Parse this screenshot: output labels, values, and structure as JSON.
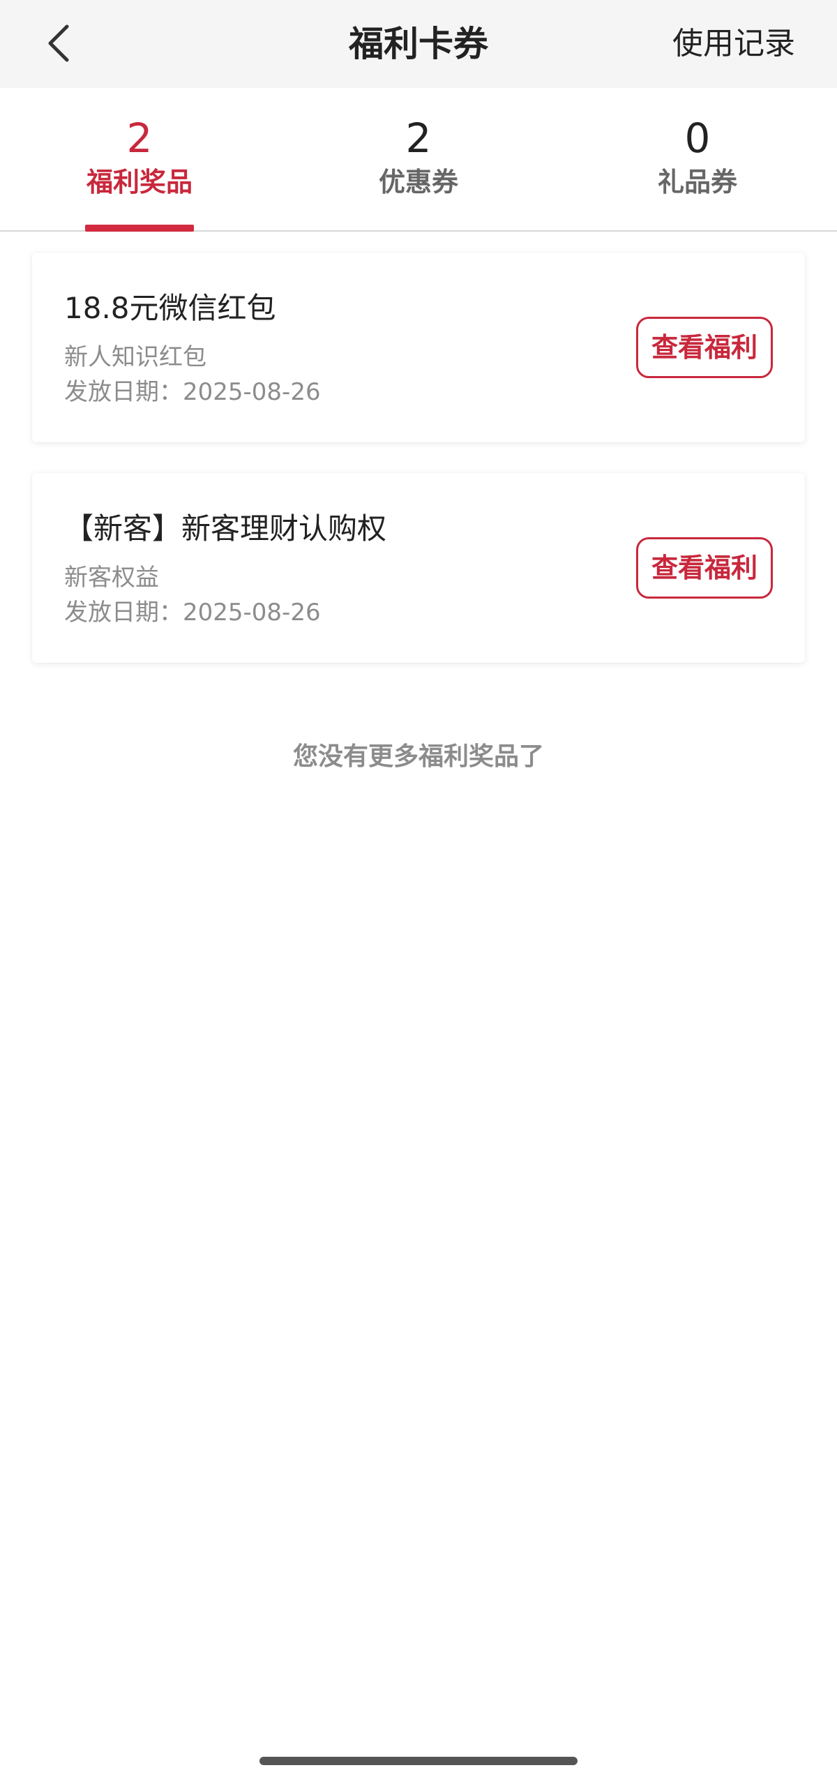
{
  "header": {
    "title": "福利卡券",
    "history_label": "使用记录",
    "back_icon": "chevron-left-icon"
  },
  "tabs": [
    {
      "count": "2",
      "label": "福利奖品",
      "active": true
    },
    {
      "count": "2",
      "label": "优惠券",
      "active": false
    },
    {
      "count": "0",
      "label": "礼品券",
      "active": false
    }
  ],
  "cards": [
    {
      "title": "18.8元微信红包",
      "subtitle": "新人知识红包",
      "date": "发放日期：2025-08-26",
      "button_label": "查看福利"
    },
    {
      "title": "【新客】新客理财认购权",
      "subtitle": "新客权益",
      "date": "发放日期：2025-08-26",
      "button_label": "查看福利"
    }
  ],
  "footer": {
    "end_text": "您没有更多福利奖品了"
  },
  "colors": {
    "accent": "#c8283c",
    "header_bg": "#f5f5f5",
    "muted_text": "#8c8c8c"
  }
}
